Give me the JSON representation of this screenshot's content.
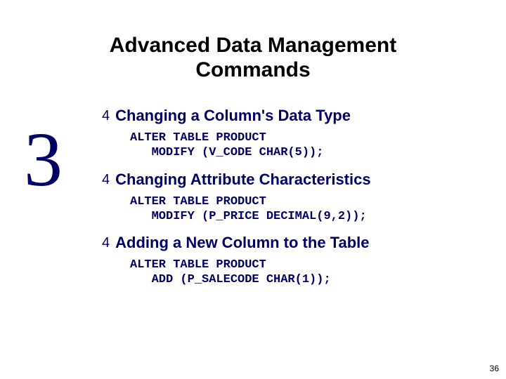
{
  "title": "Advanced Data Management\nCommands",
  "chapter_number": "3",
  "bullet_glyph": "4",
  "sections": [
    {
      "heading": "Changing a Column's Data Type",
      "code": "ALTER TABLE PRODUCT\n   MODIFY (V_CODE CHAR(5));"
    },
    {
      "heading": "Changing Attribute Characteristics",
      "code": "ALTER TABLE PRODUCT\n   MODIFY (P_PRICE DECIMAL(9,2));"
    },
    {
      "heading": "Adding a New Column to the Table",
      "code": "ALTER TABLE PRODUCT\n   ADD (P_SALECODE CHAR(1));"
    }
  ],
  "page_number": "36",
  "colors": {
    "accent": "#000064"
  }
}
